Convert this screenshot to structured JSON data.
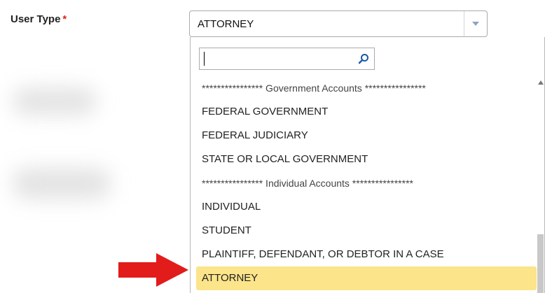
{
  "form": {
    "user_type_label": "User Type",
    "required_mark": "*",
    "selected_value": "ATTORNEY"
  },
  "dropdown": {
    "search_value": "",
    "options": [
      {
        "label": "**************** Government Accounts ****************",
        "kind": "group"
      },
      {
        "label": "FEDERAL GOVERNMENT",
        "kind": "option"
      },
      {
        "label": "FEDERAL JUDICIARY",
        "kind": "option"
      },
      {
        "label": "STATE OR LOCAL GOVERNMENT",
        "kind": "option"
      },
      {
        "label": "**************** Individual Accounts ****************",
        "kind": "group"
      },
      {
        "label": "INDIVIDUAL",
        "kind": "option"
      },
      {
        "label": "STUDENT",
        "kind": "option"
      },
      {
        "label": "PLAINTIFF, DEFENDANT, OR DEBTOR IN A CASE",
        "kind": "option"
      },
      {
        "label": "ATTORNEY",
        "kind": "option",
        "highlighted": true
      }
    ]
  },
  "colors": {
    "highlight": "#fbe48a",
    "required": "#d9251c",
    "annotation_arrow": "#e21b1b"
  },
  "icons": {
    "select_arrow": "chevron-down-icon",
    "search": "search-icon",
    "annotation": "red-arrow-icon"
  }
}
